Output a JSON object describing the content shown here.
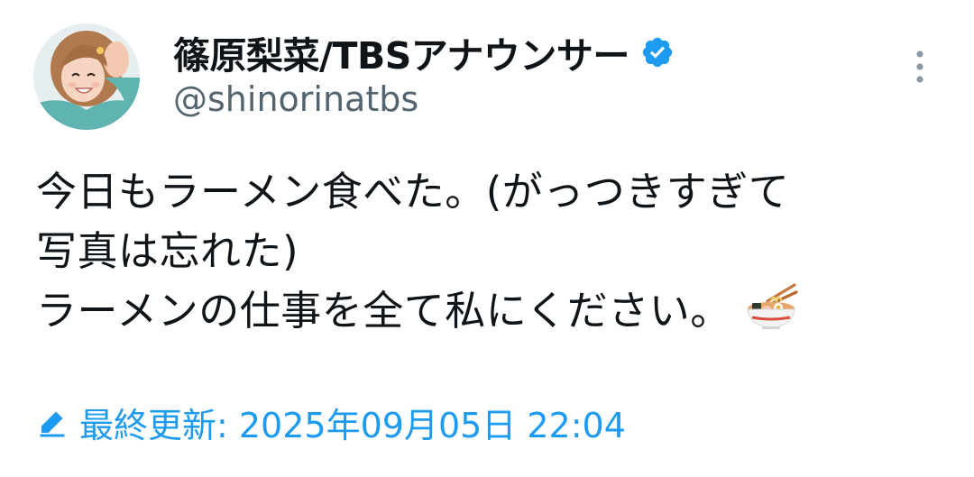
{
  "author": {
    "display_name": "篠原梨菜/TBSアナウンサー",
    "handle": "@shinorinatbs",
    "verified": true
  },
  "tweet": {
    "lines": [
      "今日もラーメン食べた。(がっつきすぎて",
      "写真は忘れた)",
      "ラーメンの仕事を全て私にください。"
    ],
    "emoji": "ramen-bowl-icon"
  },
  "edit_info": {
    "label": "最終更新: 2025年09月05日 22:04"
  },
  "colors": {
    "link_blue": "#1d9bf0",
    "secondary_text": "#536471",
    "primary_text": "#0f1419"
  }
}
